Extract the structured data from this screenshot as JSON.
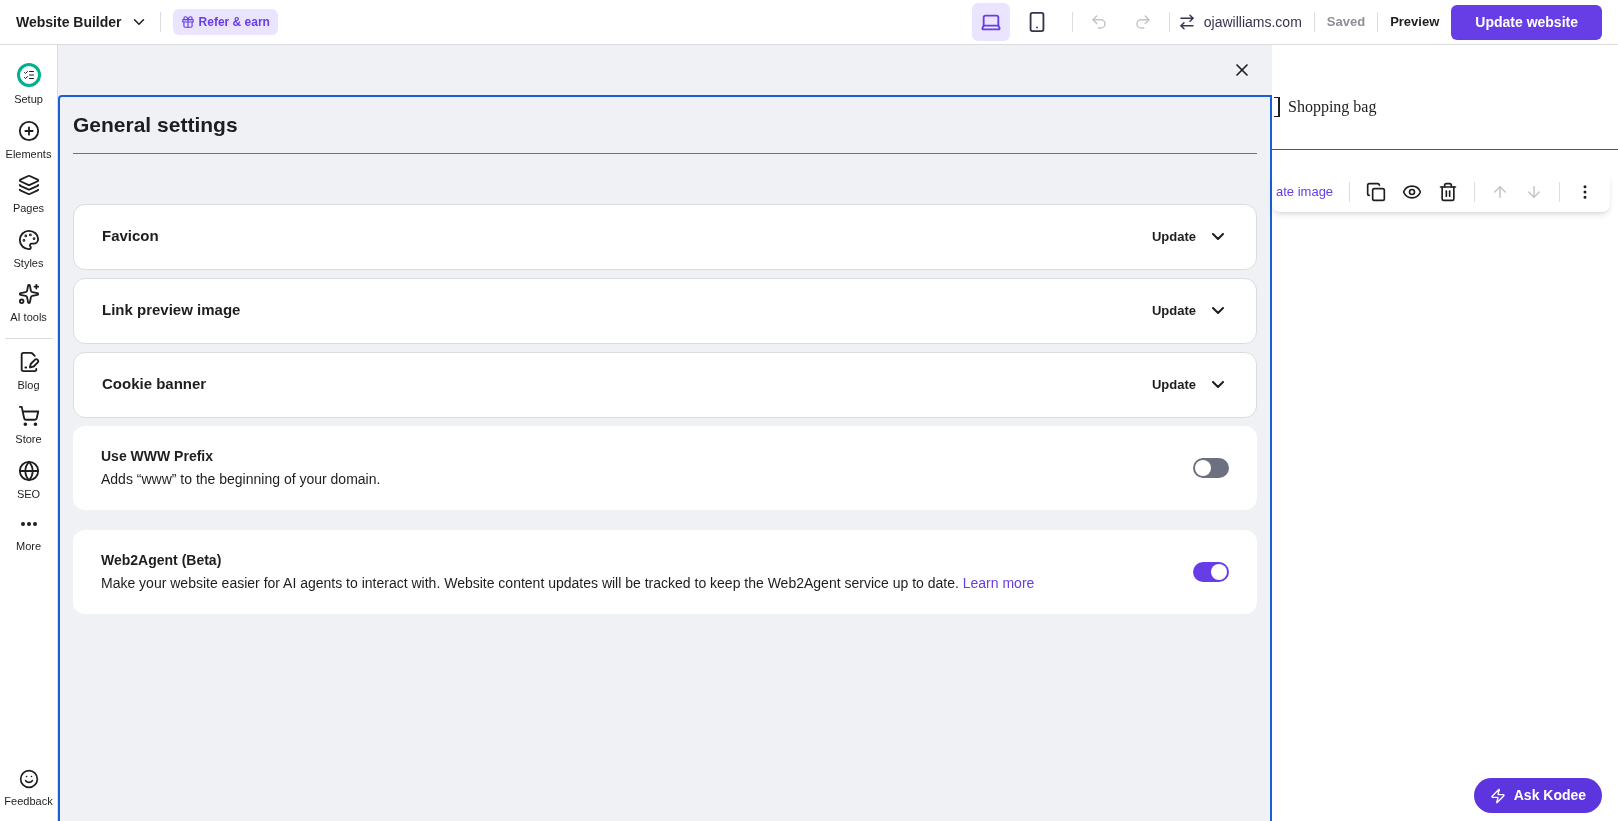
{
  "topbar": {
    "app_menu": "Website Builder",
    "refer": "Refer & earn",
    "views": [
      {
        "kind": "desktop",
        "selected": true
      },
      {
        "kind": "mobile",
        "selected": false
      }
    ],
    "domain": "ojawilliams.com",
    "saved": "Saved",
    "preview": "Preview",
    "update": "Update website"
  },
  "sidebar": {
    "items": [
      {
        "label": "Setup",
        "kind": "setup"
      },
      {
        "label": "Elements",
        "kind": "elements"
      },
      {
        "label": "Pages",
        "kind": "pages"
      },
      {
        "label": "Styles",
        "kind": "styles"
      },
      {
        "label": "AI tools",
        "kind": "ai"
      },
      {
        "label": "Blog",
        "kind": "blog"
      },
      {
        "label": "Store",
        "kind": "store"
      },
      {
        "label": "SEO",
        "kind": "seo"
      },
      {
        "label": "More",
        "kind": "more"
      }
    ],
    "feedback": "Feedback"
  },
  "panel": {
    "title": "General settings",
    "sections": [
      {
        "kind": "accordion",
        "title": "Favicon",
        "action": "Update",
        "expanded": false
      },
      {
        "kind": "accordion",
        "title": "Link preview image",
        "action": "Update",
        "expanded": false
      },
      {
        "kind": "accordion",
        "title": "Cookie banner",
        "action": "Update",
        "expanded": false
      },
      {
        "kind": "toggle",
        "title": "Use WWW Prefix",
        "description": "Adds “www” to the beginning of your domain.",
        "on": false
      },
      {
        "kind": "toggle",
        "title": "Web2Agent (Beta)",
        "description": "Make your website easier for AI agents to interact with. Website content updates will be tracked to keep the Web2Agent service up to date.",
        "link": "Learn more",
        "on": true
      }
    ]
  },
  "canvas": {
    "nav_text": "Shopping bag",
    "toolbar_action": "ate image"
  },
  "assistant": "Ask Kodee"
}
